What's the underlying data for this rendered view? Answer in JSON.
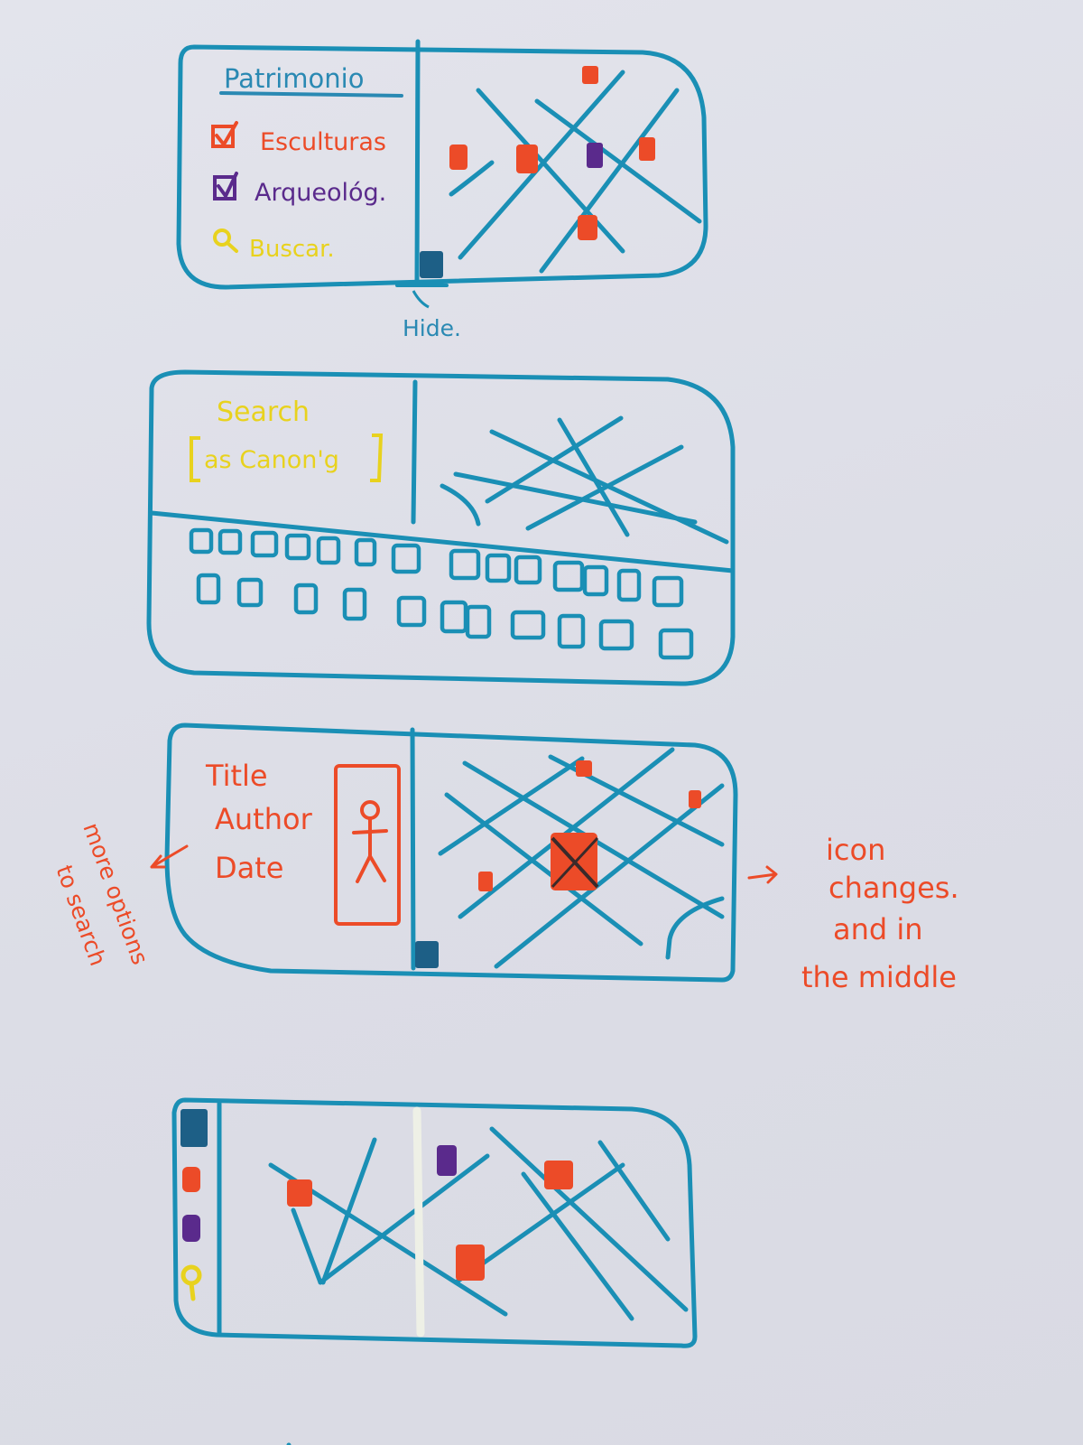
{
  "colors": {
    "ink_blue": "#1a8fb5",
    "marker_orange": "#ec4b28",
    "marker_purple": "#5a2a8c",
    "marker_yellow": "#e8d21e",
    "marker_navy": "#1d5f86",
    "correction_white": "#eef0e6"
  },
  "sketch1": {
    "heading": "Patrimonio",
    "layers": [
      {
        "label": "Esculturas",
        "checked": true,
        "color": "#ec4b28"
      },
      {
        "label": "Arqueológ.",
        "checked": true,
        "color": "#5a2a8c"
      }
    ],
    "search_label": "Buscar.",
    "search_icon": "magnifier-icon",
    "hide_note": "Hide."
  },
  "sketch2": {
    "search_label": "Search",
    "search_field": "as Canon'g"
  },
  "sketch3": {
    "fields": [
      "Title",
      "Author",
      "Date"
    ],
    "note_left": [
      "more options",
      "to search"
    ],
    "note_right": [
      "icon",
      "changes.",
      "and in",
      "the middle"
    ]
  },
  "sketch4": {
    "rail_icons": [
      "layers-icon",
      "sculpture-icon",
      "archaeology-icon",
      "search-icon"
    ]
  }
}
